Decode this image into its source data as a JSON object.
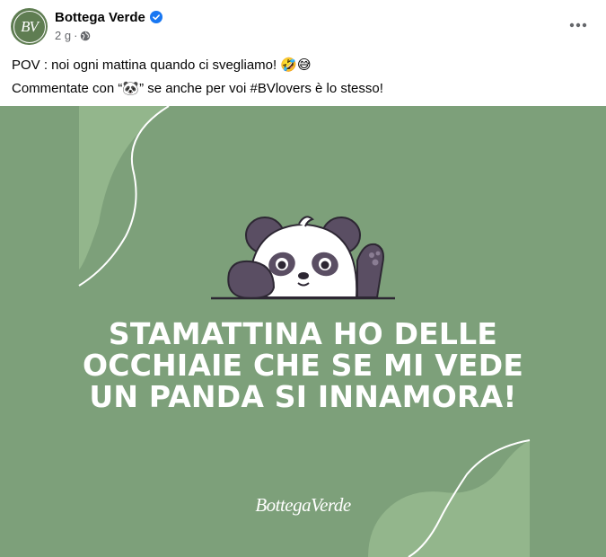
{
  "post": {
    "page_name": "Bottega Verde",
    "avatar_initials": "BV",
    "time": "2 g",
    "separator": "·",
    "caption_line1": "POV : noi ogni mattina quando ci svegliamo! 🤣😅",
    "caption_line2_prefix": "Commentate con “",
    "caption_line2_emoji": "🐼",
    "caption_line2_suffix": "” se anche per voi #BVlovers è lo stesso!",
    "icons": {
      "verified": "verified-badge-icon",
      "globe": "globe-icon",
      "more": "more-options-icon"
    },
    "colors": {
      "verified": "#1877f2",
      "image_bg": "#7da07a",
      "blob": "#93b68c",
      "meta_text": "#65676b"
    }
  },
  "image": {
    "headline": [
      "STAMATTINA HO DELLE",
      "OCCHIAIE CHE SE MI VEDE",
      "UN PANDA SI INNAMORA!"
    ],
    "brand_logo": "BottegaVerde",
    "illustration": "panda-waving"
  }
}
